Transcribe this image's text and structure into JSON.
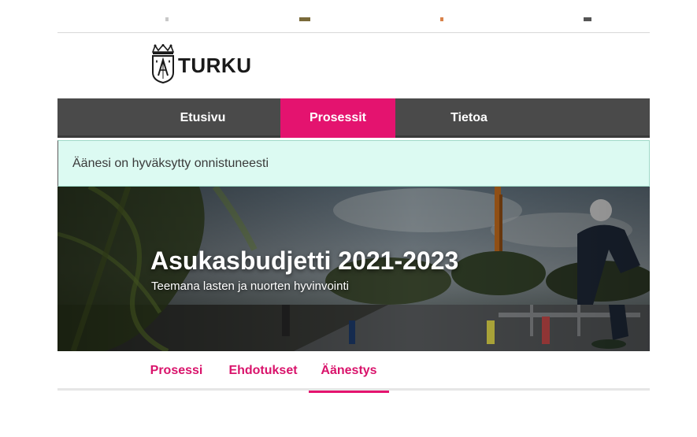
{
  "brand": {
    "name": "TURKU",
    "logo_icon": "turku-coat-of-arms-icon"
  },
  "main_nav": {
    "items": [
      {
        "label": "Etusivu",
        "active": false
      },
      {
        "label": "Prosessit",
        "active": true
      },
      {
        "label": "Tietoa",
        "active": false
      }
    ]
  },
  "flash": {
    "message": "Äänesi on hyväksytty onnistuneesti"
  },
  "hero": {
    "title": "Asukasbudjetti 2021-2023",
    "subtitle": "Teemana lasten ja nuorten hyvinvointi"
  },
  "process_tabs": {
    "items": [
      {
        "label": "Prosessi",
        "active": false
      },
      {
        "label": "Ehdotukset",
        "active": false
      },
      {
        "label": "Äänestys",
        "active": true
      }
    ]
  },
  "colors": {
    "accent": "#e4136f",
    "nav_background": "#4a4a4a",
    "flash_background": "#dcfaf2",
    "tab_text": "#d9136b"
  }
}
